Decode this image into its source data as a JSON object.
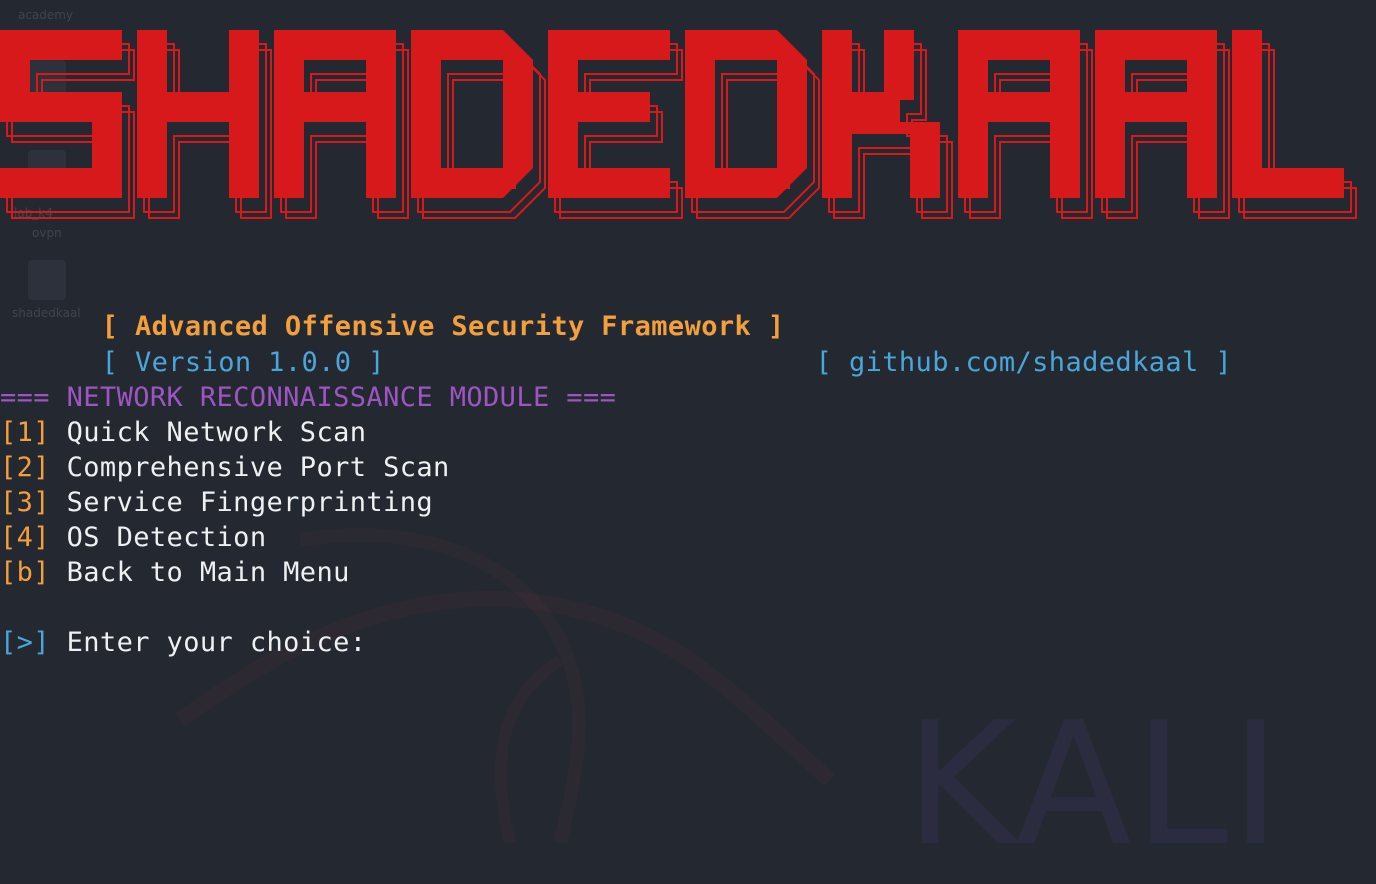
{
  "banner": {
    "text": "SHADEDKAAL",
    "color": "#d7191c"
  },
  "header": {
    "tagline_open": "[",
    "tagline": "Advanced Offensive Security Framework",
    "tagline_close": "]",
    "version_open": "[",
    "version": "Version 1.0.0",
    "version_close": "]",
    "repo_open": "[",
    "repo": "github.com/shadedkaal",
    "repo_close": "]"
  },
  "module": {
    "title_prefix": "===",
    "title": "NETWORK RECONNAISSANCE MODULE",
    "title_suffix": "==="
  },
  "menu": {
    "items": [
      {
        "key": "[1]",
        "label": "Quick Network Scan"
      },
      {
        "key": "[2]",
        "label": "Comprehensive Port Scan"
      },
      {
        "key": "[3]",
        "label": "Service Fingerprinting"
      },
      {
        "key": "[4]",
        "label": "OS Detection"
      },
      {
        "key": "[b]",
        "label": "Back to Main Menu"
      }
    ]
  },
  "prompt": {
    "marker": "[>]",
    "label": "Enter your choice:",
    "value": ""
  },
  "desktop": {
    "icons": [
      "academy",
      "lab_k4",
      "ovpn",
      "shadedkaal"
    ],
    "wallpaper_text": "KALI"
  },
  "colors": {
    "background": "#242830",
    "accent_orange": "#f39f3c",
    "accent_blue": "#4aa6d9",
    "accent_purple": "#9d55c1",
    "text": "#eef0f2",
    "banner_red": "#d7191c"
  }
}
